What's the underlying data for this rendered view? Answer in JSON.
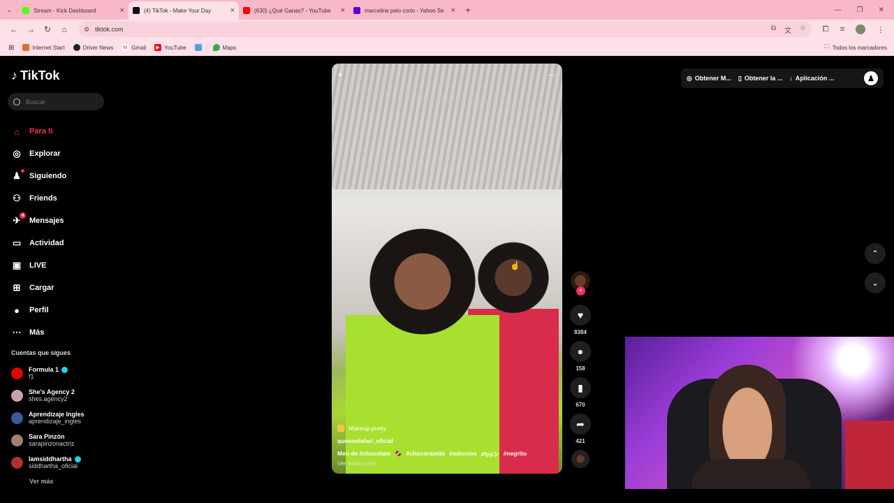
{
  "browser": {
    "tabs": [
      {
        "title": "Stream - Kick Dashboard",
        "color": "#53fc18",
        "active": false
      },
      {
        "title": "(4) TikTok - Make Your Day",
        "color": "#111111",
        "active": true
      },
      {
        "title": "(630) ¿Qué Ganas? - YouTube",
        "color": "#ff0000",
        "active": false
      },
      {
        "title": "marceline pelo corto - Yahoo Se",
        "color": "#6001d2",
        "active": false
      }
    ],
    "url": "tiktok.com",
    "bookmarks": [
      "Internet Start",
      "Driver News",
      "Gmail",
      "YouTube",
      "",
      "Maps"
    ],
    "bookmarks_folder": "Todos los marcadores"
  },
  "tiktok": {
    "logo": "TikTok",
    "search_placeholder": "Buscar",
    "nav": [
      {
        "label": "Para ti",
        "icon": "home-icon",
        "active": true
      },
      {
        "label": "Explorar",
        "icon": "compass-icon"
      },
      {
        "label": "Siguiendo",
        "icon": "following-icon",
        "dot": true
      },
      {
        "label": "Friends",
        "icon": "friends-icon"
      },
      {
        "label": "Mensajes",
        "icon": "messages-icon",
        "badge": "4"
      },
      {
        "label": "Actividad",
        "icon": "activity-icon"
      },
      {
        "label": "LIVE",
        "icon": "live-icon"
      },
      {
        "label": "Cargar",
        "icon": "upload-icon"
      },
      {
        "label": "Perfil",
        "icon": "profile-icon"
      },
      {
        "label": "Más",
        "icon": "more-icon"
      }
    ],
    "follows_title": "Cuentas que sigues",
    "follows": [
      {
        "name": "Formula 1",
        "user": "f1",
        "verified": true,
        "color": "#e10600"
      },
      {
        "name": "She's Agency 2",
        "user": "shes.agency2",
        "verified": false,
        "color": "#c9a0b0"
      },
      {
        "name": "Aprendizaje Ingles",
        "user": "aprendizaje_ingles",
        "verified": false,
        "color": "#3a5a9a"
      },
      {
        "name": "Sara Pinzón",
        "user": "sarapinzonactriz",
        "verified": false,
        "color": "#a08070"
      },
      {
        "name": "Iamsiddhartha",
        "user": "siddhartha_oficial",
        "verified": true,
        "color": "#b03030"
      }
    ],
    "ver_mas": "Ver más",
    "video": {
      "effect": "Makeup pretty",
      "author": "queenstafari_oficial",
      "description": [
        "Men de #chocolate",
        "🍫",
        "#chocoramito",
        "#adiccion",
        "#fypシ",
        "#negrito"
      ],
      "translate": "Ver traducción"
    },
    "actions": {
      "likes": "8384",
      "comments": "158",
      "saves": "670",
      "shares": "421"
    },
    "topbar": {
      "coins": "Obtener M...",
      "app": "Obtener la ...",
      "download": "Aplicación ..."
    }
  }
}
